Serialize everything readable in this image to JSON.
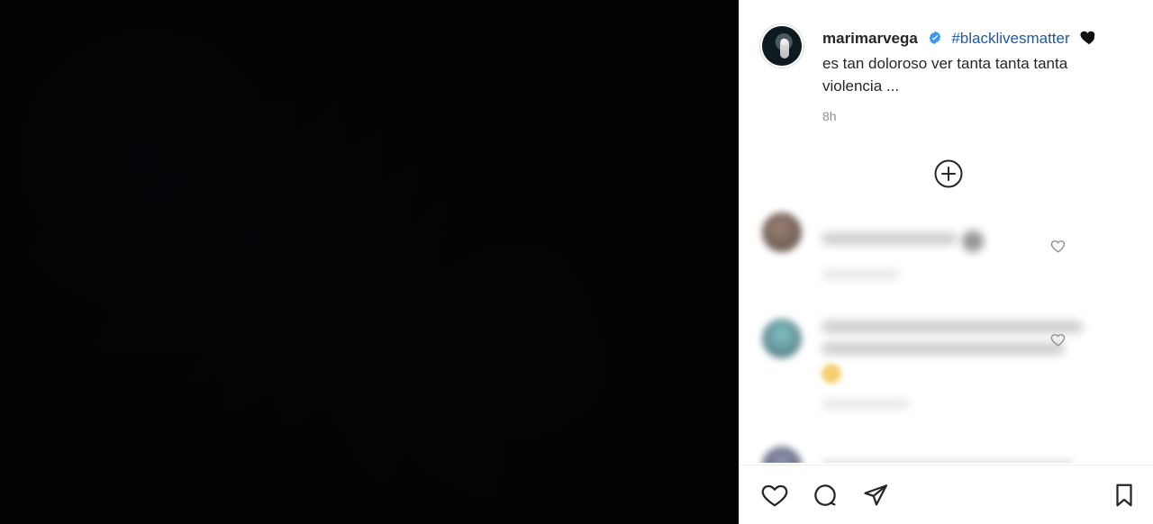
{
  "post": {
    "username": "marimarvega",
    "hashtag": "#blacklivesmatter",
    "caption_line2": "es tan doloroso ver tanta tanta tanta",
    "caption_line3": "violencia ...",
    "time": "8h"
  },
  "icons": {
    "verified": "verified-badge-icon",
    "heart_emoji": "black-heart-emoji-icon",
    "load_more": "plus-circle-icon",
    "like": "heart-outline-icon",
    "comment": "comment-bubble-icon",
    "share": "paper-plane-icon",
    "save": "bookmark-outline-icon"
  },
  "colors": {
    "hashtag": "#1a5aa6",
    "verified": "#3897f0",
    "panel_bg": "#ffffff",
    "media_bg": "#020203"
  },
  "comments": [
    {
      "blurred": true
    },
    {
      "blurred": true
    },
    {
      "blurred": true
    }
  ]
}
